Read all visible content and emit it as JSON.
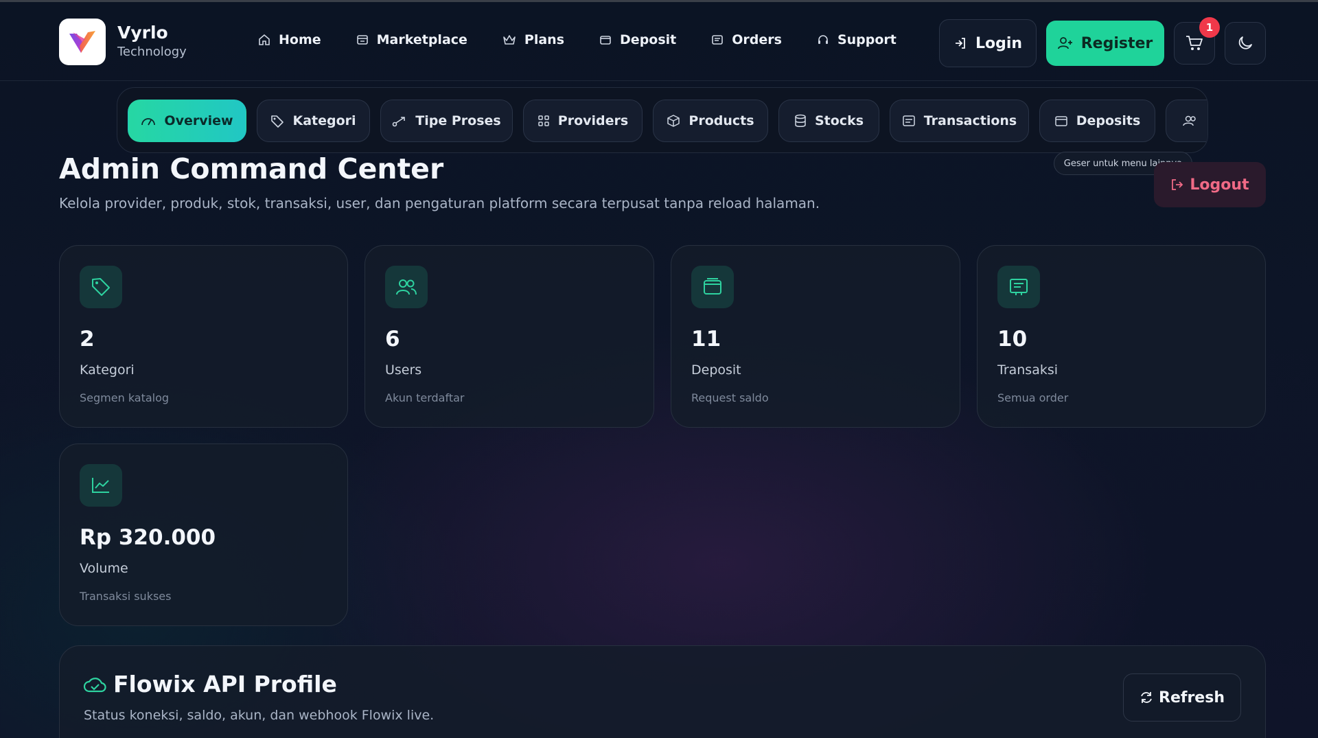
{
  "brand": {
    "name": "Vyrlo",
    "subtitle": "Technology"
  },
  "nav": {
    "links": [
      {
        "label": "Home",
        "icon": "home-icon"
      },
      {
        "label": "Marketplace",
        "icon": "store-icon"
      },
      {
        "label": "Plans",
        "icon": "crown-icon"
      },
      {
        "label": "Deposit",
        "icon": "wallet-icon"
      },
      {
        "label": "Orders",
        "icon": "receipt-icon"
      },
      {
        "label": "Support",
        "icon": "headset-icon"
      }
    ],
    "login_label": "Login",
    "register_label": "Register",
    "cart_count": "1"
  },
  "tabs": [
    {
      "label": "Overview",
      "icon": "gauge-icon",
      "active": true
    },
    {
      "label": "Kategori",
      "icon": "tag-icon"
    },
    {
      "label": "Tipe Proses",
      "icon": "route-icon"
    },
    {
      "label": "Providers",
      "icon": "grid-icon"
    },
    {
      "label": "Products",
      "icon": "box-icon"
    },
    {
      "label": "Stocks",
      "icon": "database-icon"
    },
    {
      "label": "Transactions",
      "icon": "receipt-icon"
    },
    {
      "label": "Deposits",
      "icon": "wallet-icon"
    }
  ],
  "tab_hint": "Geser untuk menu lainnya",
  "header": {
    "title": "Admin Command Center",
    "subtitle": "Kelola provider, produk, stok, transaksi, user, dan pengaturan platform secara terpusat tanpa reload halaman.",
    "logout_label": "Logout"
  },
  "stats": [
    {
      "value": "2",
      "label": "Kategori",
      "sub": "Segmen katalog",
      "icon": "tag-icon"
    },
    {
      "value": "6",
      "label": "Users",
      "sub": "Akun terdaftar",
      "icon": "users-icon"
    },
    {
      "value": "11",
      "label": "Deposit",
      "sub": "Request saldo",
      "icon": "wallet-icon"
    },
    {
      "value": "10",
      "label": "Transaksi",
      "sub": "Semua order",
      "icon": "receipt-icon"
    },
    {
      "value": "Rp 320.000",
      "label": "Volume",
      "sub": "Transaksi sukses",
      "icon": "chart-icon"
    }
  ],
  "api_profile": {
    "title": "Flowix API Profile",
    "subtitle": "Status koneksi, saldo, akun, dan webhook Flowix live.",
    "refresh_label": "Refresh"
  },
  "colors": {
    "accent": "#1fd39a",
    "danger": "#f06a86",
    "badge": "#f0384a"
  }
}
